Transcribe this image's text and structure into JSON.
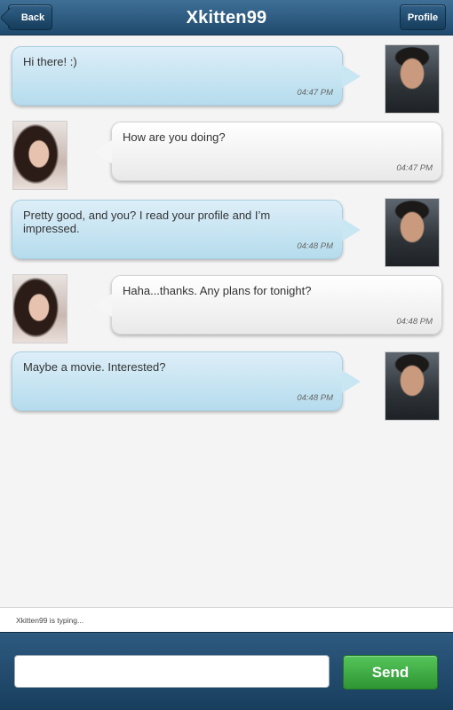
{
  "header": {
    "title": "Xkitten99",
    "back_label": "Back",
    "profile_label": "Profile"
  },
  "messages": [
    {
      "direction": "out",
      "text": "Hi there! :)",
      "time": "04:47 PM",
      "avatar": "male-avatar"
    },
    {
      "direction": "in",
      "text": "How are you doing?",
      "time": "04:47 PM",
      "avatar": "female-avatar"
    },
    {
      "direction": "out",
      "text": "Pretty good, and you? I read your profile and I’m impressed.",
      "time": "04:48 PM",
      "avatar": "male-avatar"
    },
    {
      "direction": "in",
      "text": "Haha...thanks. Any plans for tonight?",
      "time": "04:48 PM",
      "avatar": "female-avatar"
    },
    {
      "direction": "out",
      "text": "Maybe a movie. Interested?",
      "time": "04:48 PM",
      "avatar": "male-avatar"
    }
  ],
  "typing_status": "Xkitten99 is typing...",
  "composer": {
    "input_value": "",
    "placeholder": "",
    "send_label": "Send"
  },
  "colors": {
    "header": "#2b5679",
    "outgoing_bubble": "#c9e6f3",
    "incoming_bubble": "#f6f6f6",
    "send_button": "#3fae45"
  }
}
